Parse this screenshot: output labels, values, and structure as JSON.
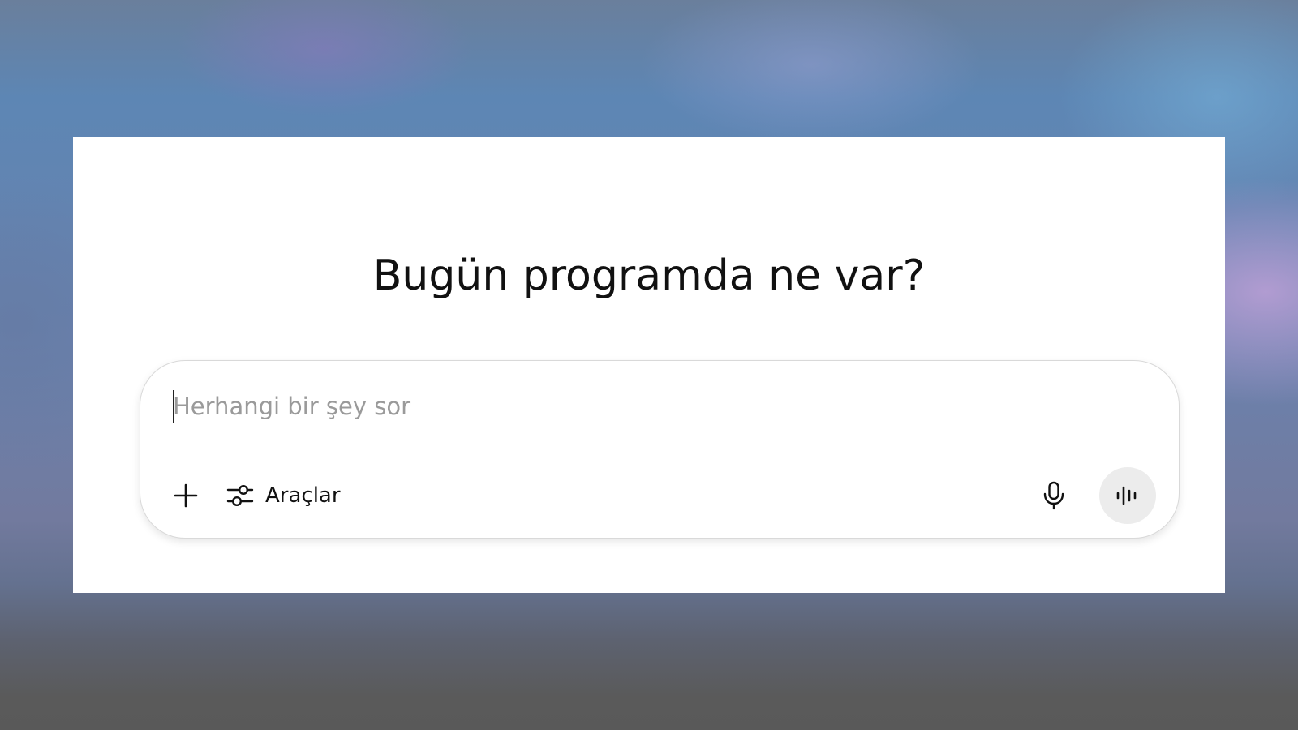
{
  "page": {
    "headline": "Bugün programda ne var?"
  },
  "composer": {
    "placeholder": "Herhangi bir şey sor",
    "value": "",
    "toolbar": {
      "add_icon": "plus-icon",
      "tools_icon": "sliders-icon",
      "tools_label": "Araçlar",
      "mic_icon": "microphone-icon",
      "voice_icon": "voice-waveform-icon"
    }
  },
  "colors": {
    "card_background": "#ffffff",
    "text": "#111111",
    "placeholder": "#9a9a9a",
    "voice_button_background": "#ececec"
  }
}
